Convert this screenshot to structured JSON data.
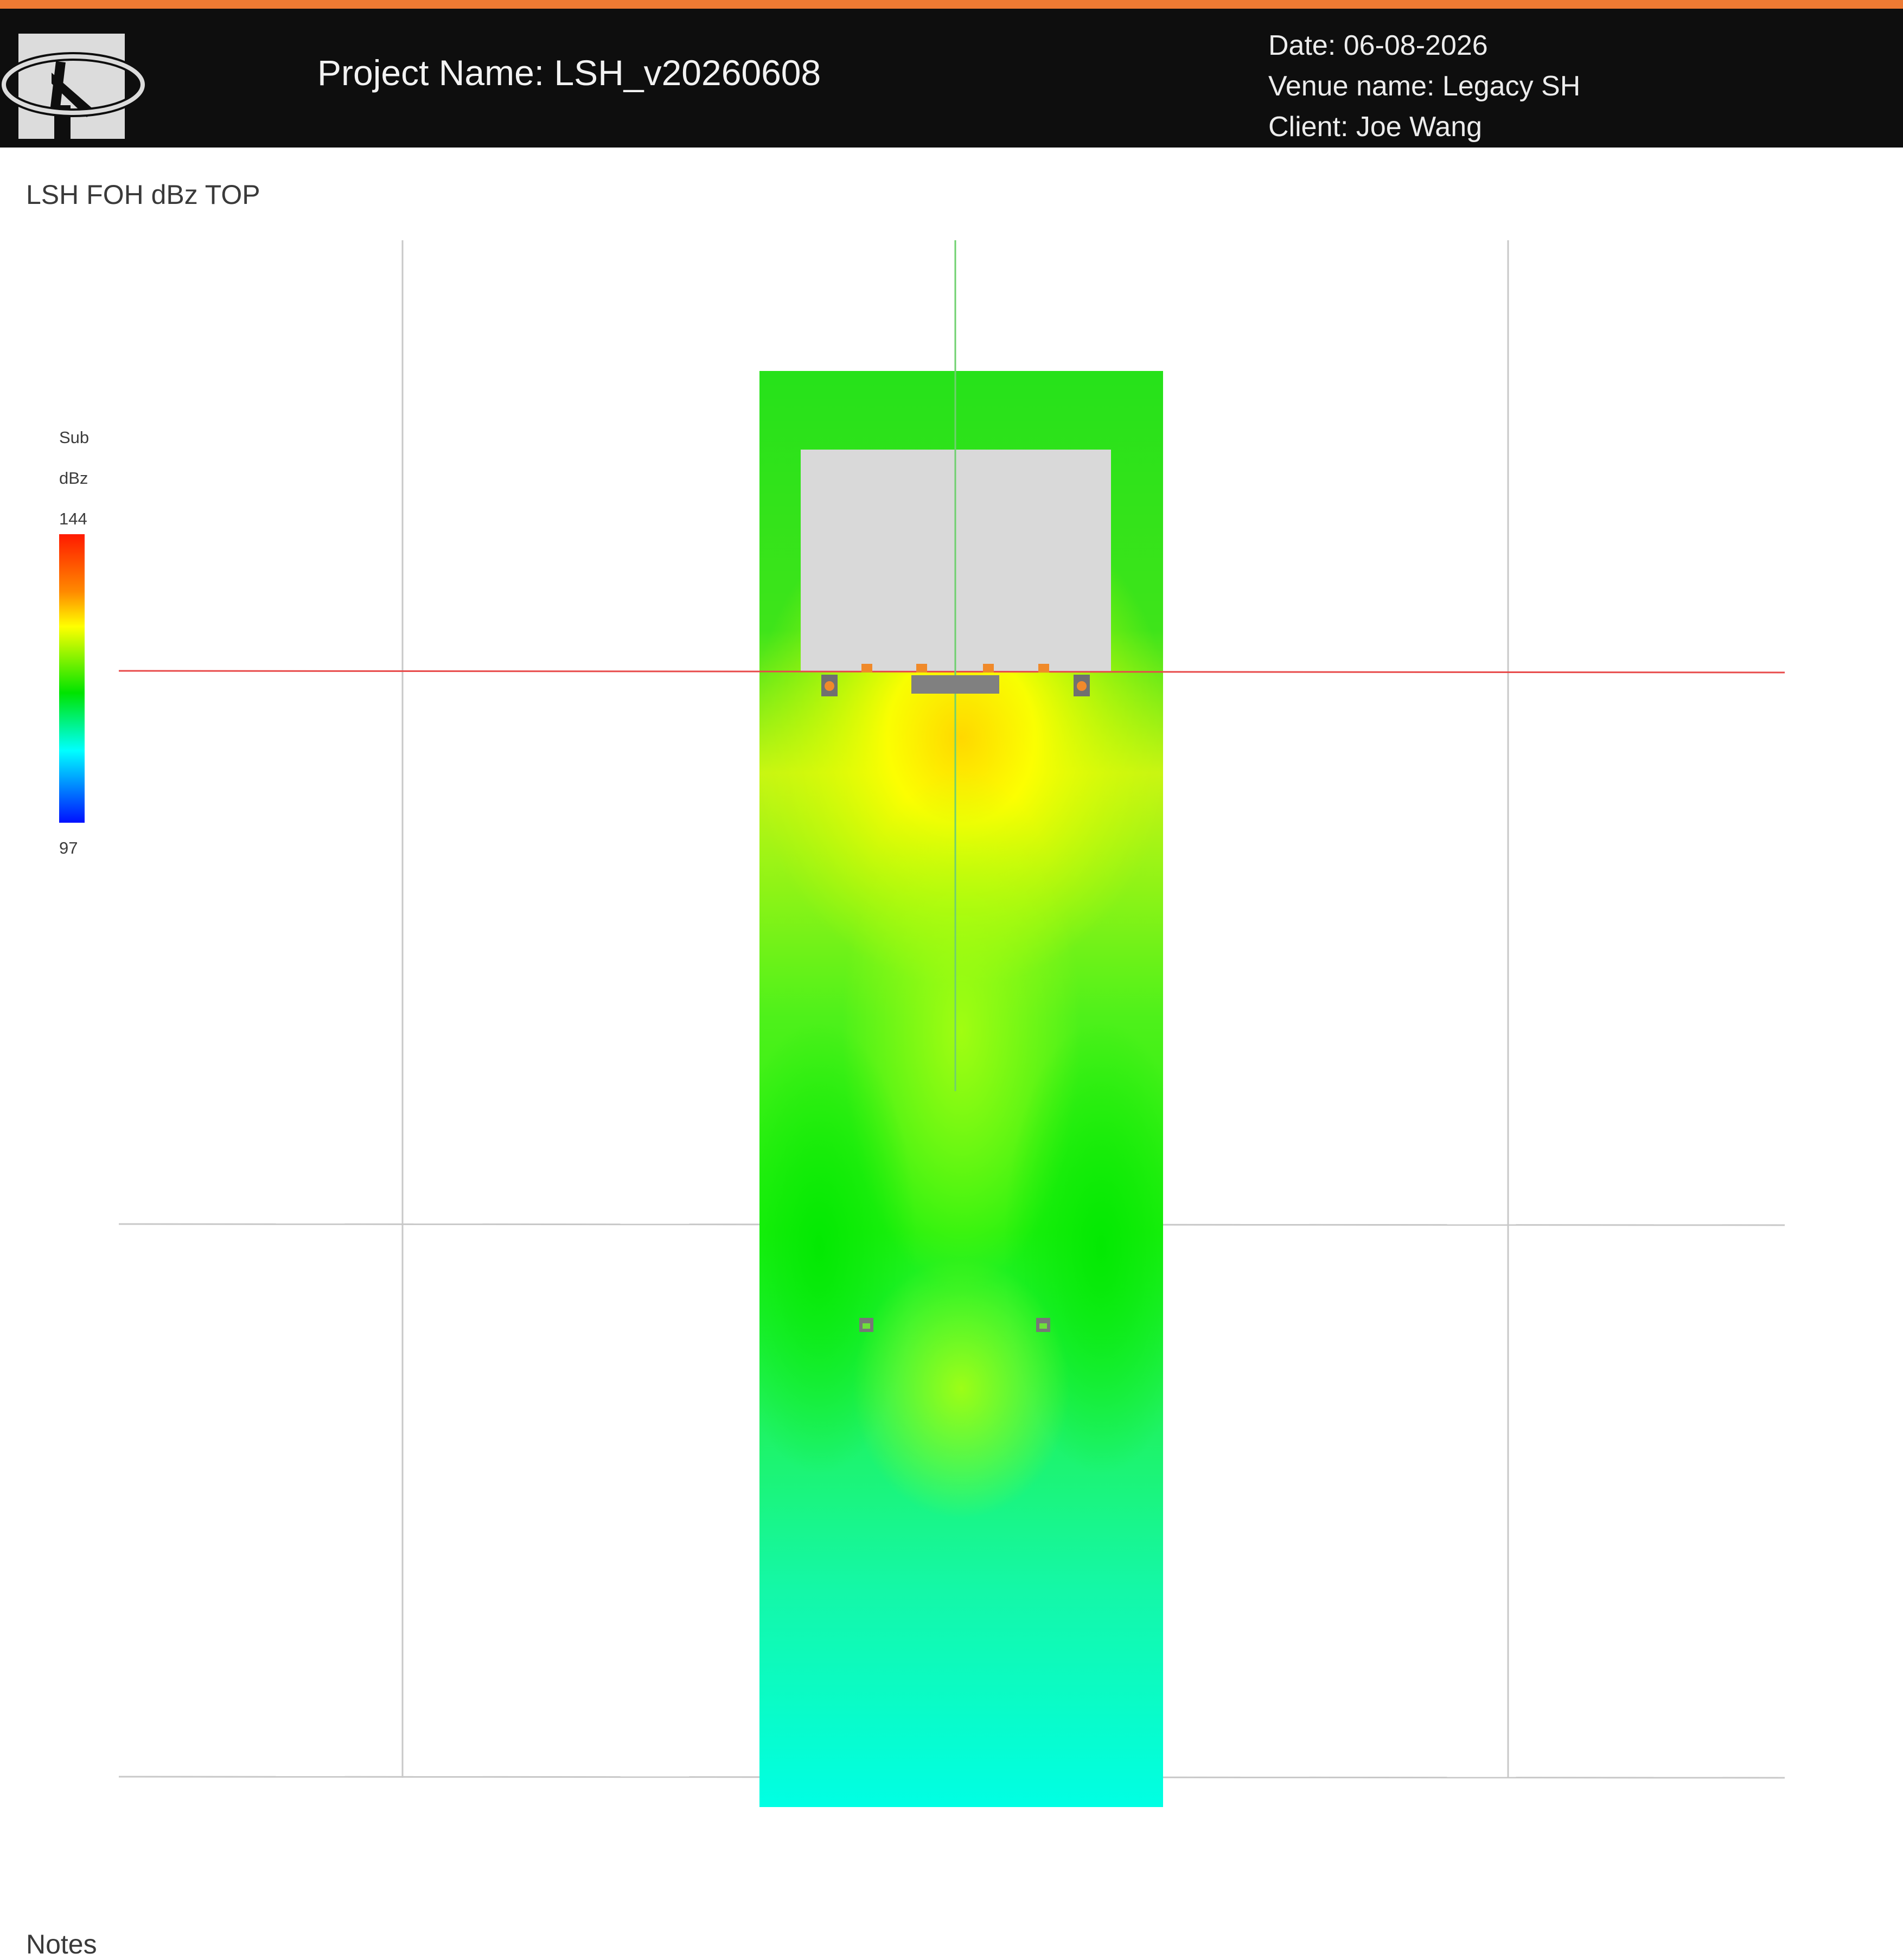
{
  "header": {
    "project_name": "Project Name: LSH_v20260608",
    "date": "Date: 06-08-2026",
    "venue": "Venue name: Legacy SH",
    "client": "Client: Joe Wang"
  },
  "view": {
    "title": "LSH FOH dBz TOP"
  },
  "legend": {
    "line1": "Sub",
    "line2": "dBz",
    "max_label": "144",
    "min_label": "97",
    "max_value": 144,
    "min_value": 97,
    "gradient_colors": [
      "#ff1a00",
      "#ff8a00",
      "#ffff00",
      "#00e400",
      "#00ffff",
      "#0010ff"
    ]
  },
  "colors": {
    "accent": "#ee7a33",
    "header_bg": "#0e0e0e",
    "stage": "#d9d9d9",
    "speaker": "#808080",
    "driver": "#f08a2a",
    "axis_x": "#e84a4a",
    "axis_y": "#6fd06f",
    "grid": "#c8c8c8"
  },
  "footer": {
    "notes_label": "Notes"
  }
}
